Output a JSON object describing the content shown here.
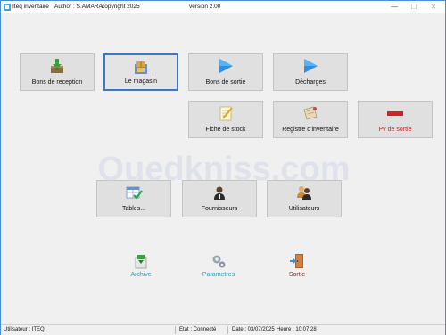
{
  "titlebar": {
    "app_name": "Iteq inventaire",
    "author": "Author : S.AMARA",
    "copyright": "copyright 2025",
    "version": "version 2.00",
    "minimize": "—",
    "maximize": "☐",
    "close": "✕"
  },
  "tiles": {
    "bons_reception": "Bons de reception",
    "magasin": "Le magasin",
    "bons_sortie": "Bons de sortie",
    "decharges": "Décharges",
    "fiche_stock": "Fiche de stock",
    "registre": "Registre d'inventaire",
    "pv_sortie": "Pv de sortie",
    "tables": "Tables...",
    "fournisseurs": "Fournisseurs",
    "utilisateurs": "Utilisateurs"
  },
  "bottom": {
    "archive": "Archive",
    "parametres": "Parametres",
    "sortie": "Sortie"
  },
  "watermark": "Ouedkniss.com",
  "status": {
    "user": "Utilisateur : ITEQ",
    "etat": "Etat : Connecté",
    "date": "Date : 03/07/2025",
    "heure": "Heure : 10:07:28"
  },
  "colors": {
    "accent": "#3a78c4",
    "teal_label": "#2a9bb0",
    "red_label": "#c62020"
  },
  "icons": {
    "bons_reception": "download-box-icon",
    "magasin": "warehouse-box-icon",
    "bons_sortie": "blue-play-arrow-icon",
    "decharges": "blue-play-arrow-icon",
    "fiche_stock": "notepad-pencil-icon",
    "registre": "ledger-icon",
    "pv_sortie": "red-minus-icon",
    "tables": "table-check-icon",
    "fournisseurs": "user-icon",
    "utilisateurs": "users-icon",
    "archive": "archive-icon",
    "parametres": "gears-icon",
    "sortie": "exit-door-icon"
  }
}
